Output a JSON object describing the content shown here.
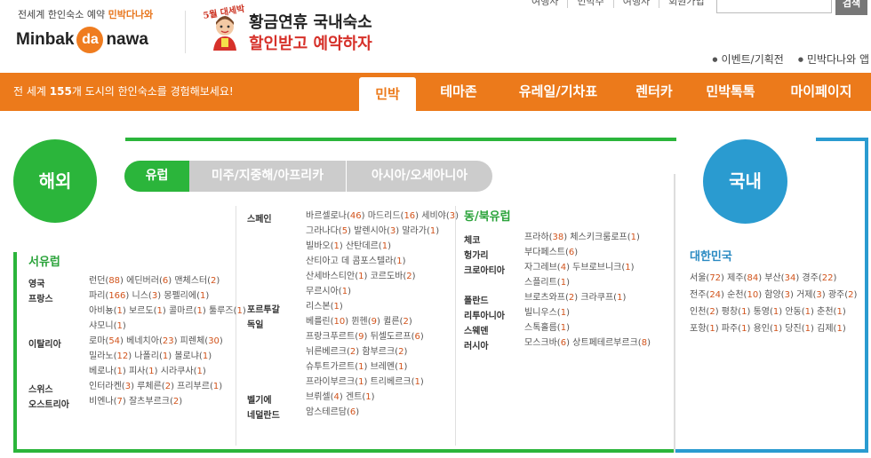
{
  "header": {
    "tagline_prefix": "전세계 한인숙소 예약",
    "tagline_brand": "민박다나와",
    "logo_left": "Minbak",
    "logo_circle": "da",
    "logo_right": "nawa",
    "promo_badge": "5월 대세박",
    "promo_line1": "황금연휴 국내숙소",
    "promo_line2": "할인받고 예약하자",
    "top_links": [
      "여행사",
      "민박주",
      "여행사",
      "회원가입"
    ],
    "search_button": "검색",
    "util_links": [
      "이벤트/기획전",
      "민박다나와 앱"
    ]
  },
  "nav": {
    "message_prefix": "전 세계",
    "message_count": "155",
    "message_suffix": "개 도시의 한인숙소를 경험해보세요!",
    "tabs": [
      "민박",
      "테마존",
      "유레일/기차표",
      "렌터카",
      "민박톡톡",
      "마이페이지"
    ]
  },
  "sections": {
    "abroad": "해외",
    "domestic": "국내"
  },
  "region_tabs": [
    "유럽",
    "미주/지중해/아프리카",
    "아시아/오세아니아"
  ],
  "west_europe": {
    "title": "서유럽",
    "rows": [
      {
        "country": "영국",
        "lines": [
          [
            [
              "런던",
              "88"
            ],
            [
              "에딘버러",
              "6"
            ],
            [
              "맨체스터",
              "2"
            ]
          ]
        ]
      },
      {
        "country": "프랑스",
        "lines": [
          [
            [
              "파리",
              "166"
            ],
            [
              "니스",
              "3"
            ],
            [
              "몽펠리에",
              "1"
            ]
          ],
          [
            [
              "아비뇽",
              "1"
            ],
            [
              "보르도",
              "1"
            ],
            [
              "콜마르",
              "1"
            ],
            [
              "툴루즈",
              "1"
            ]
          ],
          [
            [
              "샤모니",
              "1"
            ]
          ]
        ]
      },
      {
        "country": "이탈리아",
        "lines": [
          [
            [
              "로마",
              "54"
            ],
            [
              "베네치아",
              "23"
            ],
            [
              "피렌체",
              "30"
            ]
          ],
          [
            [
              "밀라노",
              "12"
            ],
            [
              "나폴리",
              "1"
            ],
            [
              "볼로냐",
              "1"
            ]
          ],
          [
            [
              "베로나",
              "1"
            ],
            [
              "피사",
              "1"
            ],
            [
              "시라쿠사",
              "1"
            ]
          ]
        ]
      },
      {
        "country": "스위스",
        "lines": [
          [
            [
              "인터라켄",
              "3"
            ],
            [
              "루체른",
              "2"
            ],
            [
              "프리부르",
              "1"
            ]
          ]
        ]
      },
      {
        "country": "오스트리아",
        "lines": [
          [
            [
              "비엔나",
              "7"
            ],
            [
              "잘츠부르크",
              "2"
            ]
          ]
        ]
      }
    ]
  },
  "mid_europe": {
    "rows": [
      {
        "country": "스페인",
        "lines": [
          [
            [
              "바르셀로나",
              "46"
            ],
            [
              "마드리드",
              "16"
            ],
            [
              "세비야",
              "3"
            ]
          ],
          [
            [
              "그라나다",
              "5"
            ],
            [
              "발렌시아",
              "3"
            ],
            [
              "말라가",
              "1"
            ]
          ],
          [
            [
              "빌바오",
              "1"
            ],
            [
              "산탄데르",
              "1"
            ]
          ],
          [
            [
              "산티아고 데 콤포스텔라",
              "1"
            ]
          ],
          [
            [
              "산세바스티안",
              "1"
            ],
            [
              "코르도바",
              "2"
            ]
          ],
          [
            [
              "무르시아",
              "1"
            ]
          ]
        ]
      },
      {
        "country": "포르투갈",
        "lines": [
          [
            [
              "리스본",
              "1"
            ]
          ]
        ]
      },
      {
        "country": "독일",
        "lines": [
          [
            [
              "베를린",
              "10"
            ],
            [
              "뮌헨",
              "9"
            ],
            [
              "퀼른",
              "2"
            ]
          ],
          [
            [
              "프랑크푸르트",
              "9"
            ],
            [
              "뒤셀도르프",
              "6"
            ]
          ],
          [
            [
              "뉘른베르크",
              "2"
            ],
            [
              "함부르크",
              "2"
            ]
          ],
          [
            [
              "슈투트가르트",
              "1"
            ],
            [
              "브레멘",
              "1"
            ]
          ],
          [
            [
              "프라이부르크",
              "1"
            ],
            [
              "트리베르크",
              "1"
            ]
          ]
        ]
      },
      {
        "country": "벨기에",
        "lines": [
          [
            [
              "브뤼셀",
              "4"
            ],
            [
              "겐트",
              "1"
            ]
          ]
        ]
      },
      {
        "country": "네덜란드",
        "lines": [
          [
            [
              "암스테르담",
              "6"
            ]
          ]
        ]
      }
    ]
  },
  "east_europe": {
    "title": "동/북유럽",
    "rows": [
      {
        "country": "체코",
        "lines": [
          [
            [
              "프라하",
              "38"
            ],
            [
              "체스키크룸로프",
              "1"
            ]
          ]
        ]
      },
      {
        "country": "헝가리",
        "lines": [
          [
            [
              "부다페스트",
              "6"
            ]
          ]
        ]
      },
      {
        "country": "크로아티아",
        "lines": [
          [
            [
              "자그레브",
              "4"
            ],
            [
              "두브로브니크",
              "1"
            ]
          ],
          [
            [
              "스플리트",
              "1"
            ]
          ]
        ]
      },
      {
        "country": "폴란드",
        "lines": [
          [
            [
              "브로츠와프",
              "2"
            ],
            [
              "크라쿠프",
              "1"
            ]
          ]
        ]
      },
      {
        "country": "리투아니아",
        "lines": [
          [
            [
              "빌니우스",
              "1"
            ]
          ]
        ]
      },
      {
        "country": "스웨덴",
        "lines": [
          [
            [
              "스톡홀름",
              "1"
            ]
          ]
        ]
      },
      {
        "country": "러시아",
        "lines": [
          [
            [
              "모스크바",
              "6"
            ],
            [
              "상트페테르부르크",
              "8"
            ]
          ]
        ]
      }
    ]
  },
  "korea": {
    "title": "대한민국",
    "lines": [
      [
        [
          "서울",
          "72"
        ],
        [
          "제주",
          "84"
        ],
        [
          "부산",
          "34"
        ],
        [
          "경주",
          "22"
        ]
      ],
      [
        [
          "전주",
          "24"
        ],
        [
          "순천",
          "10"
        ],
        [
          "함양",
          "3"
        ],
        [
          "거제",
          "3"
        ],
        [
          "광주",
          "2"
        ]
      ],
      [
        [
          "인천",
          "2"
        ],
        [
          "평창",
          "1"
        ],
        [
          "통영",
          "1"
        ],
        [
          "안동",
          "1"
        ],
        [
          "춘천",
          "1"
        ]
      ],
      [
        [
          "포항",
          "1"
        ],
        [
          "파주",
          "1"
        ],
        [
          "용인",
          "1"
        ],
        [
          "당진",
          "1"
        ],
        [
          "김제",
          "1"
        ]
      ]
    ]
  },
  "colors": {
    "orange": "#ec7a1b",
    "green": "#2bb53b",
    "blue": "#2a9bd0",
    "count_red": "#d2541c"
  }
}
